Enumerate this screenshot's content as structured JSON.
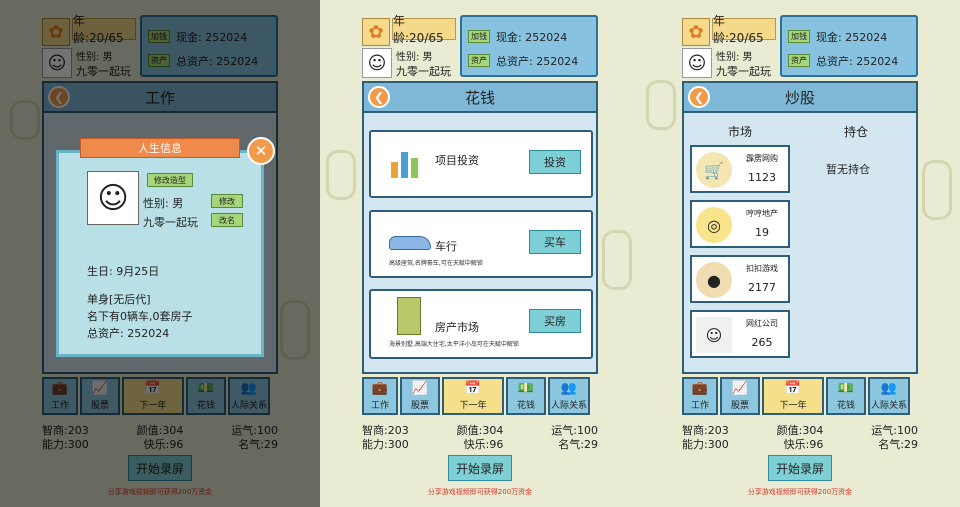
{
  "player": {
    "age": "年龄:20/65",
    "gender": "性别: 男",
    "name": "九零一起玩",
    "cash_tag": "加钱",
    "cash": "现金: 252024",
    "asset_tag": "资产",
    "assets": "总资产: 252024"
  },
  "screens": {
    "work": {
      "title": "工作"
    },
    "spend": {
      "title": "花钱",
      "cards": [
        {
          "label": "项目投资",
          "button": "投资",
          "sub": ""
        },
        {
          "label": "车行",
          "button": "买车",
          "sub": "高级座驾,名牌豪车,可在天赋中解锁"
        },
        {
          "label": "房产市场",
          "button": "买房",
          "sub": "海景别墅,高端大住宅,太平洋小岛可在天赋中解锁"
        }
      ]
    },
    "stock": {
      "title": "炒股",
      "market_label": "市场",
      "holdings_label": "持仓",
      "empty_holdings": "暂无持仓",
      "stocks": [
        {
          "name": "霹雳网购",
          "price": "1123"
        },
        {
          "name": "哼哼地产",
          "price": "19"
        },
        {
          "name": "扣扣游戏",
          "price": "2177"
        },
        {
          "name": "网红公司",
          "price": "265"
        }
      ]
    }
  },
  "modal": {
    "title": "人生信息",
    "change_look": "修改造型",
    "gender": "性别: 男",
    "edit": "修改",
    "name": "九零一起玩",
    "rename": "改名",
    "birthday": "生日: 9月25日",
    "marital": "单身[无后代]",
    "property": "名下有0辆车,0套房子",
    "assets": "总资产: 252024"
  },
  "nav": [
    {
      "label": "工作",
      "icon": "briefcase-icon"
    },
    {
      "label": "股票",
      "icon": "chart-icon"
    },
    {
      "label": "下一年",
      "icon": "calendar-icon"
    },
    {
      "label": "花钱",
      "icon": "money-icon"
    },
    {
      "label": "人际关系",
      "icon": "people-icon"
    }
  ],
  "stats": {
    "iq": "智商:203",
    "looks": "颜值:304",
    "luck": "运气:100",
    "ability": "能力:300",
    "happy": "快乐:96",
    "fame": "名气:29"
  },
  "record_button": "开始录屏",
  "share_text": "分享游戏视频即可获得200万资金",
  "colors": {
    "accent": "#7fb8d6",
    "orange": "#f39a4a",
    "green": "#a6d67a",
    "red": "#d23a2a"
  }
}
